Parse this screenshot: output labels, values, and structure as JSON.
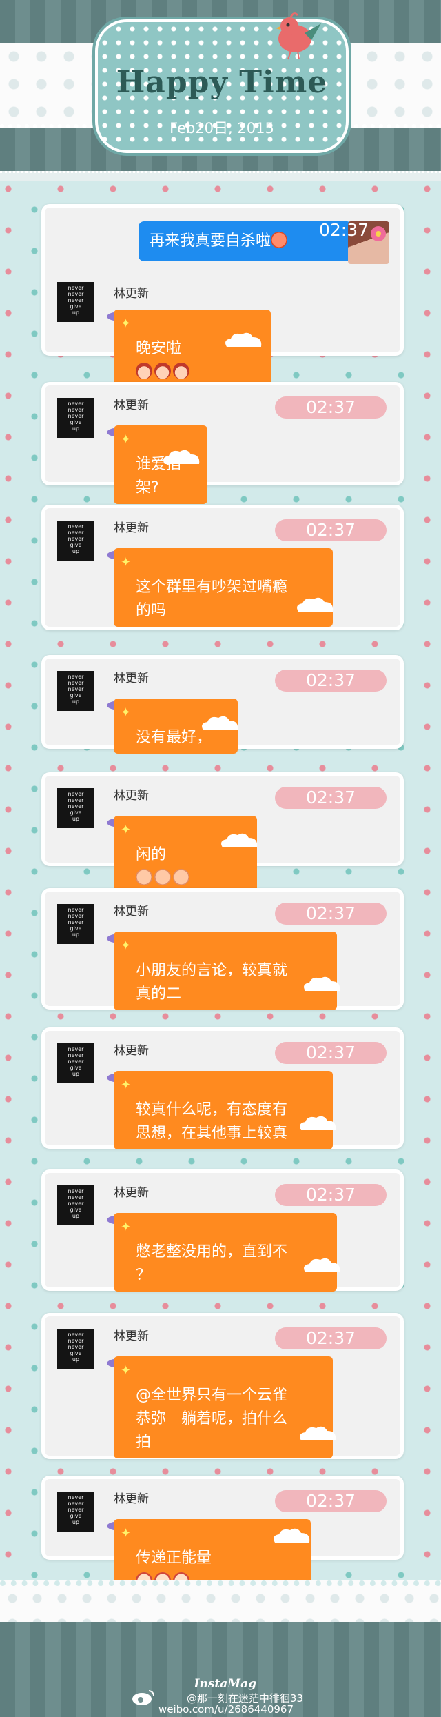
{
  "header": {
    "title": "Happy Time",
    "date": "Feb20日, 2015"
  },
  "first_message": {
    "text": "再来我真要自杀啦",
    "time": "02:37"
  },
  "sender_name": "林更新",
  "avatar_text": [
    "never",
    "never",
    "never",
    "give",
    "up"
  ],
  "messages": [
    {
      "text": "晚安啦",
      "time": "",
      "emoji_count": 3
    },
    {
      "text": "谁爱掐架?",
      "time": "02:37"
    },
    {
      "text": "这个群里有吵架过嘴瘾\n的吗",
      "time": "02:37"
    },
    {
      "text": "没有最好，",
      "time": "02:37"
    },
    {
      "text": "闲的",
      "time": "02:37",
      "emoji_count": 3
    },
    {
      "text": "小朋友的言论，较真就\n真的二",
      "time": "02:37"
    },
    {
      "text": "较真什么呢，有态度有\n思想，在其他事上较真",
      "time": "02:37"
    },
    {
      "text": "憋老整没用的，直到不\n？",
      "time": "02:37"
    },
    {
      "text": "@全世界只有一个云雀\n恭弥　躺着呢，拍什么\n拍",
      "time": "02:37"
    },
    {
      "text": "传递正能量",
      "time": "02:37",
      "emoji_count": 3
    }
  ],
  "footer": {
    "brand": "InstaMag",
    "weibo_line1": "@那一刻在迷茫中徘徊33",
    "weibo_line2": "weibo.com/u/2686440967"
  }
}
